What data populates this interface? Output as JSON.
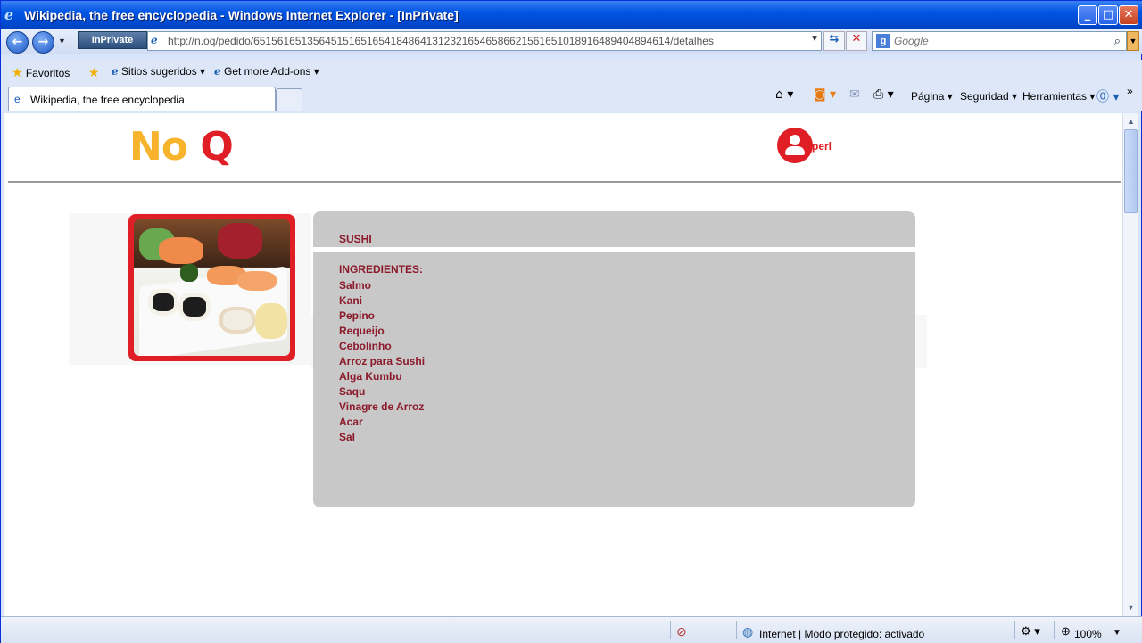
{
  "window": {
    "title": "Wikipedia, the free encyclopedia - Windows Internet Explorer - [InPrivate]",
    "buttons": {
      "minimize": "_",
      "maximize": "□",
      "close": "✕"
    }
  },
  "addressbar": {
    "inprivate_label": "InPrivate",
    "url": "http://n.oq/pedido/6515616513564515165165418486413123216546586621561651018916489404894614/detalhes"
  },
  "search": {
    "placeholder": "Google"
  },
  "favorites": {
    "favoritos_label": "Favoritos",
    "sitios_label": "Sitios sugeridos",
    "addons_label": "Get more Add-ons"
  },
  "tabs": [
    {
      "label": "Wikipedia, the free encyclopedia"
    }
  ],
  "commandbar": {
    "pagina": "Página",
    "seguridad": "Seguridad",
    "herramientas": "Herramientas"
  },
  "page": {
    "logo_no": "No",
    "logo_q": "Q",
    "profile_label": "perl",
    "product_name": "SUSHI",
    "ingredients_heading": "INGREDIENTES:",
    "ingredients": [
      "Salmo",
      "Kani",
      "Pepino",
      "Requeijo",
      "Cebolinho",
      "Arroz para Sushi",
      "Alga Kumbu",
      "Saqu",
      "Vinagre de Arroz",
      "Acar",
      "Sal"
    ]
  },
  "statusbar": {
    "zone_text": "Internet | Modo protegido: activado",
    "zoom": "100%"
  },
  "colors": {
    "brand_red": "#e01e26",
    "brand_yellow": "#f6b32b",
    "ingredient_text": "#8b1a2b",
    "card_bg": "#c8c8c8"
  }
}
